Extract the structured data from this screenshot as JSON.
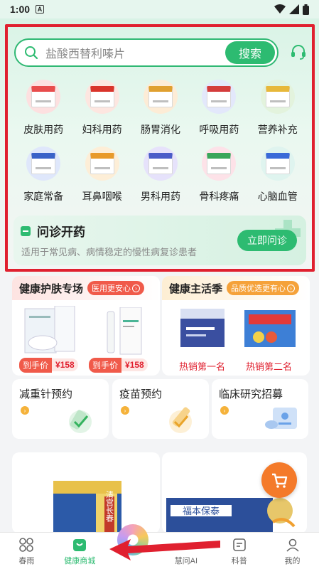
{
  "status_bar": {
    "time": "1:00",
    "notif_letter": "A"
  },
  "search": {
    "placeholder": "盐酸西替利嗪片",
    "button_label": "搜索"
  },
  "categories": [
    {
      "label": "皮肤用药",
      "bg": "#fde0e0",
      "box": "#e84c4c"
    },
    {
      "label": "妇科用药",
      "bg": "#fde6e0",
      "box": "#d9342b"
    },
    {
      "label": "肠胃消化",
      "bg": "#fdecd6",
      "box": "#e0a030"
    },
    {
      "label": "呼吸用药",
      "bg": "#e3e8fb",
      "box": "#d43c3c"
    },
    {
      "label": "营养补充",
      "bg": "#e3f3dd",
      "box": "#e7b83a"
    },
    {
      "label": "家庭常备",
      "bg": "#dfe7fb",
      "box": "#3a62c8"
    },
    {
      "label": "耳鼻咽喉",
      "bg": "#fdeed7",
      "box": "#e89a2a"
    },
    {
      "label": "男科用药",
      "bg": "#e6e2fb",
      "box": "#4a5cc8"
    },
    {
      "label": "骨科疼痛",
      "bg": "#fde2e8",
      "box": "#3aa65a"
    },
    {
      "label": "心脑血管",
      "bg": "#dff4ef",
      "box": "#3a6ad8"
    }
  ],
  "consult": {
    "title": "问诊开药",
    "subtitle": "适用于常见病、病情稳定的慢性病复诊患者",
    "button_label": "立即问诊"
  },
  "promo_left": {
    "title": "健康护肤专场",
    "badge": "医用更安心",
    "price_label": "到手价",
    "prices": [
      "¥158",
      "¥158"
    ]
  },
  "promo_right": {
    "title": "健康主活季",
    "badge": "品质优选更有心",
    "ranks": [
      "热销第一名",
      "热销第二名"
    ]
  },
  "services": [
    {
      "title": "减重针预约"
    },
    {
      "title": "疫苗预约"
    },
    {
      "title": "临床研究招募"
    }
  ],
  "big_cards": {
    "left_text": "清宫长春",
    "right_text": "福本保泰"
  },
  "tabs": [
    {
      "label": "春雨"
    },
    {
      "label": "健康商城"
    },
    {
      "label": ""
    },
    {
      "label": "慧问AI"
    },
    {
      "label": "科普"
    },
    {
      "label": "我的"
    }
  ],
  "colors": {
    "accent": "#2dbb71",
    "highlight_frame": "#e0202f",
    "price": "#e0202f"
  }
}
